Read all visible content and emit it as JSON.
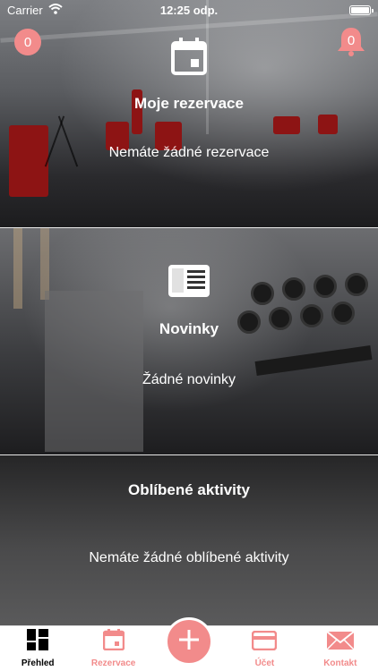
{
  "status_bar": {
    "carrier": "Carrier",
    "time": "12:25 odp.",
    "icons": [
      "wifi-icon",
      "battery-icon"
    ]
  },
  "header": {
    "left_badge": "0",
    "right_badge": "0",
    "right_icon": "bell-icon"
  },
  "sections": [
    {
      "title": "Moje rezervace",
      "message": "Nemáte žádné rezervace",
      "icon": "calendar-icon"
    },
    {
      "title": "Novinky",
      "message": "Žádné novinky",
      "icon": "news-icon"
    },
    {
      "title": "Oblíbené aktivity",
      "message": "Nemáte žádné oblíbené aktivity"
    }
  ],
  "tab_bar": {
    "items": [
      {
        "label": "Přehled",
        "icon": "grid-icon",
        "active": true
      },
      {
        "label": "Rezervace",
        "icon": "calendar-icon",
        "active": false
      },
      {
        "label": "",
        "icon": "plus-icon",
        "active": false
      },
      {
        "label": "Účet",
        "icon": "card-icon",
        "active": false
      },
      {
        "label": "Kontakt",
        "icon": "mail-icon",
        "active": false
      }
    ]
  },
  "colors": {
    "accent": "#f28b8b",
    "tab_active": "#000000",
    "tab_background": "#ffffff"
  }
}
